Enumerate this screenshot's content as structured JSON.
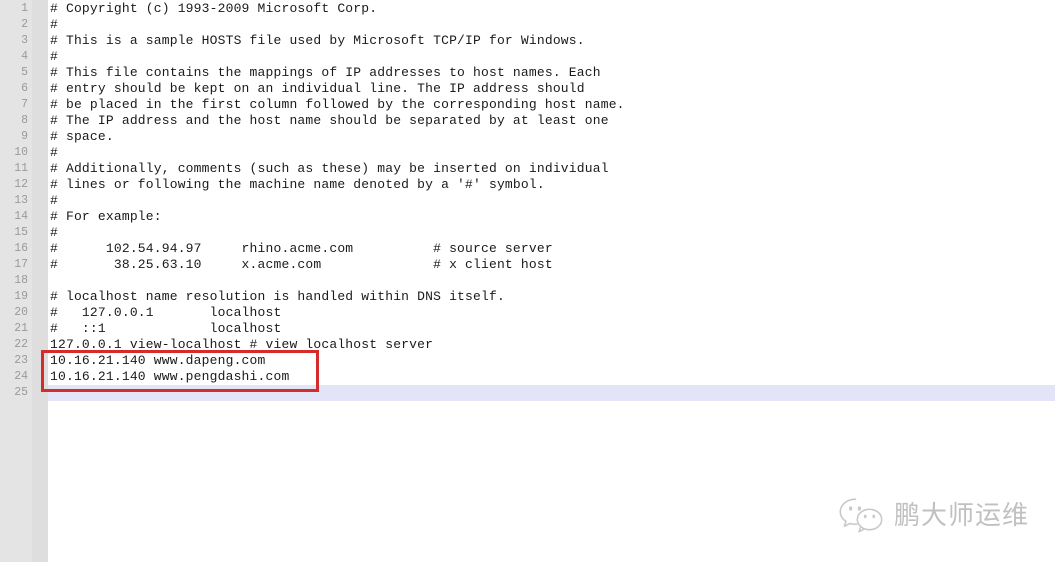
{
  "editor": {
    "type": "text-editor",
    "filename_context": "hosts",
    "colors": {
      "gutter_bg": "#e4e4e4",
      "gutter_strip_bg": "#dedede",
      "editor_bg": "#ffffff",
      "text": "#1a1a1a",
      "line_number": "#9a9a9a",
      "current_line_highlight": "#e4e4f8",
      "annotation_red": "#d42b2b",
      "watermark": "#8d8d8d"
    },
    "current_line": 25,
    "total_lines": 25,
    "lines": [
      {
        "no": "1",
        "text": "# Copyright (c) 1993-2009 Microsoft Corp."
      },
      {
        "no": "2",
        "text": "#"
      },
      {
        "no": "3",
        "text": "# This is a sample HOSTS file used by Microsoft TCP/IP for Windows."
      },
      {
        "no": "4",
        "text": "#"
      },
      {
        "no": "5",
        "text": "# This file contains the mappings of IP addresses to host names. Each"
      },
      {
        "no": "6",
        "text": "# entry should be kept on an individual line. The IP address should"
      },
      {
        "no": "7",
        "text": "# be placed in the first column followed by the corresponding host name."
      },
      {
        "no": "8",
        "text": "# The IP address and the host name should be separated by at least one"
      },
      {
        "no": "9",
        "text": "# space."
      },
      {
        "no": "10",
        "text": "#"
      },
      {
        "no": "11",
        "text": "# Additionally, comments (such as these) may be inserted on individual"
      },
      {
        "no": "12",
        "text": "# lines or following the machine name denoted by a '#' symbol."
      },
      {
        "no": "13",
        "text": "#"
      },
      {
        "no": "14",
        "text": "# For example:"
      },
      {
        "no": "15",
        "text": "#"
      },
      {
        "no": "16",
        "text": "#      102.54.94.97     rhino.acme.com          # source server"
      },
      {
        "no": "17",
        "text": "#       38.25.63.10     x.acme.com              # x client host"
      },
      {
        "no": "18",
        "text": ""
      },
      {
        "no": "19",
        "text": "# localhost name resolution is handled within DNS itself."
      },
      {
        "no": "20",
        "text": "#   127.0.0.1       localhost"
      },
      {
        "no": "21",
        "text": "#   ::1             localhost"
      },
      {
        "no": "22",
        "text": "127.0.0.1 view-localhost # view localhost server"
      },
      {
        "no": "23",
        "text": "10.16.21.140 www.dapeng.com"
      },
      {
        "no": "24",
        "text": "10.16.21.140 www.pengdashi.com"
      },
      {
        "no": "25",
        "text": ""
      }
    ]
  },
  "annotation": {
    "type": "rectangle-highlight",
    "color": "#d42b2b",
    "covers_lines": "23-24",
    "label": "highlighted-host-entries"
  },
  "watermark": {
    "icon": "wechat-icon",
    "text": "鹏大师运维"
  }
}
